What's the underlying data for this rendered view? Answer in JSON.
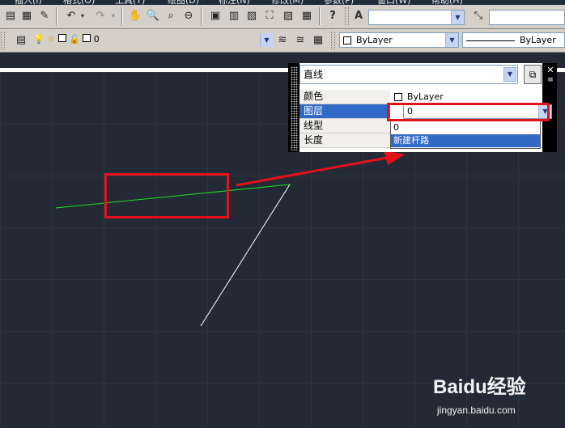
{
  "menu": {
    "items": [
      "插入(I)",
      "格式(O)",
      "工具(T)",
      "绘图(D)",
      "标注(N)",
      "修改(M)",
      "参数(P)",
      "窗口(W)",
      "帮助(H)"
    ]
  },
  "toolbar2": {
    "layer_value": "0",
    "color_value": "ByLayer",
    "linetype_value": "ByLayer"
  },
  "properties": {
    "object_type": "直线",
    "rows": [
      {
        "name": "颜色",
        "value": "ByLayer"
      },
      {
        "name": "图层",
        "value": "0"
      },
      {
        "name": "线型",
        "value": ""
      },
      {
        "name": "长度",
        "value": ""
      }
    ],
    "layer_dropdown": {
      "options": [
        "0",
        "新建杆路"
      ],
      "highlighted": "新建杆路"
    }
  },
  "watermark": {
    "brand": "Baidu经验",
    "url": "jingyan.baidu.com"
  },
  "colors": {
    "canvas": "#232a36",
    "green_line": "#22dd22",
    "white_line": "#ffffff",
    "highlight": "#e4111b",
    "selection": "#3169c6"
  }
}
